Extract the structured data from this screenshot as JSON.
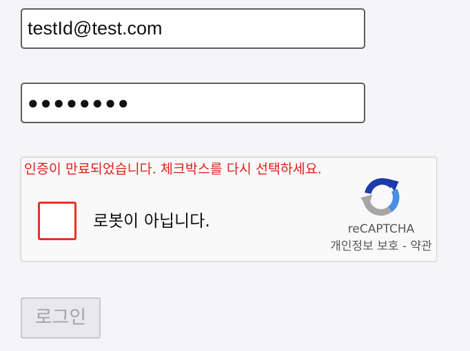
{
  "login_form": {
    "email_value": "testId@test.com",
    "password_masked": "●●●●●●●●",
    "captcha": {
      "error_message": "인증이 만료되었습니다. 체크박스를 다시 선택하세요.",
      "checkbox_label": "로봇이 아닙니다.",
      "checked": false,
      "brand_name": "reCAPTCHA",
      "privacy_link": "개인정보 보호",
      "separator": " - ",
      "terms_link": "약관"
    },
    "login_button_label": "로그인",
    "login_button_enabled": false
  },
  "colors": {
    "error_text": "#e0211b",
    "checkbox_border": "#e53125",
    "logo_blue": "#1c3aa9",
    "logo_light_blue": "#4a90e2",
    "logo_gray": "#a6a6a6"
  },
  "icons": {
    "captcha_logo": "recaptcha-logo-icon"
  }
}
